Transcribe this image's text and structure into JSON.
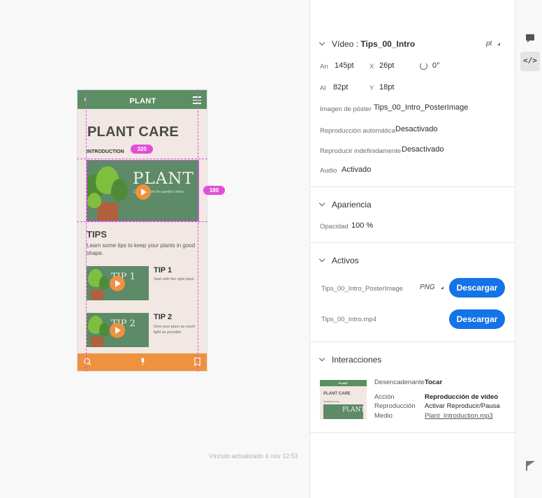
{
  "artboard": {
    "header_title": "PLANT",
    "heading": "PLANT CARE",
    "intro_label": "INTRODUCTION",
    "hero_word": "PLANT",
    "hero_sub": "Care tips from the garden center",
    "tips_title": "TIPS",
    "tips_desc": "Learn some tips to keep your plants in good shape.",
    "tips": [
      {
        "thumb_word": "TIP 1",
        "title": "TIP 1",
        "desc": "Start with the right plant"
      },
      {
        "thumb_word": "TIP 2",
        "title": "TIP 2",
        "desc": "Give your plant as much light as possible."
      }
    ]
  },
  "measurements": {
    "width_badge": "320",
    "height_badge": "180"
  },
  "canvas": {
    "link_updated": "Vínculo actualizado 4 nov 12:53"
  },
  "panel": {
    "video": {
      "title_prefix": "Vídeo : ",
      "title_name": "Tips_00_Intro",
      "unit": "pt",
      "width_label": "An",
      "width_value": "145pt",
      "x_label": "X",
      "x_value": "26pt",
      "rotation_value": "0°",
      "height_label": "Al",
      "height_value": "82pt",
      "y_label": "Y",
      "y_value": "18pt",
      "poster_label": "Imagen de póster",
      "poster_value": "Tips_00_Intro_PosterImage",
      "autoplay_label": "Reproducción automática",
      "autoplay_value": "Desactivado",
      "loop_label": "Reproducir indefinidamente",
      "loop_value": "Desactivado",
      "audio_label": "Audio",
      "audio_value": "Activado"
    },
    "appearance": {
      "title": "Apariencia",
      "opacity_label": "Opacidad",
      "opacity_value": "100 %"
    },
    "assets": {
      "title": "Activos",
      "items": [
        {
          "name": "Tips_00_Intro_PosterImage",
          "format": "PNG",
          "button": "Descargar"
        },
        {
          "name": "Tips_00_Intro.mp4",
          "button": "Descargar"
        }
      ]
    },
    "interactions": {
      "title": "Interacciones",
      "trigger_label": "Desencadenante",
      "trigger_value": "Tocar",
      "action_label": "Acción",
      "action_value": "Reproducción de vídeo",
      "playback_label": "Reproducción",
      "playback_value": "Activar Reproducir/Pausa",
      "media_label": "Medio",
      "media_value": "Plant_Introduction.mp3",
      "thumb_header": "PLANT",
      "thumb_heading": "PLANT CARE",
      "thumb_intro": "INTRODUCTION",
      "thumb_word": "PLANT"
    }
  },
  "rail": {
    "icons": [
      "comment-icon",
      "code-icon",
      "flag-icon"
    ]
  }
}
